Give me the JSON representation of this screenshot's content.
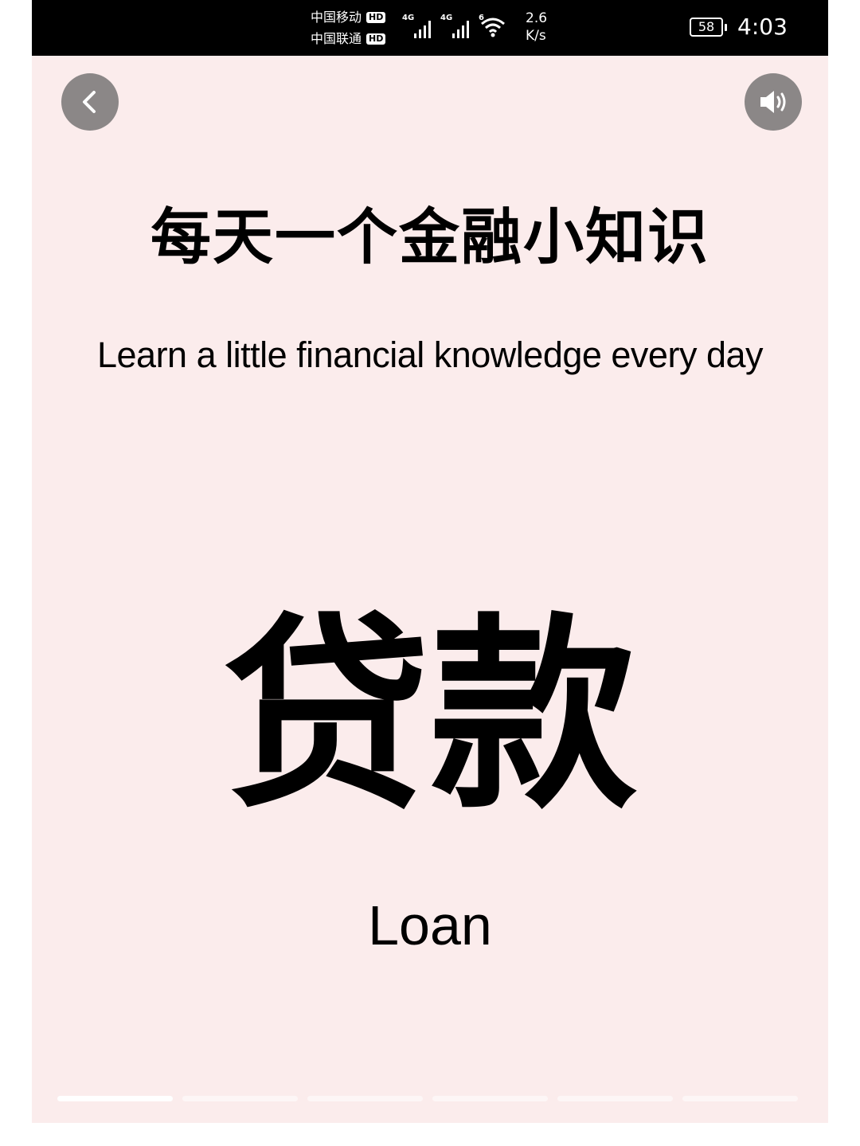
{
  "status_bar": {
    "carrier_1": "中国移动",
    "carrier_2": "中国联通",
    "hd_label": "HD",
    "signal_1_tag": "4G",
    "signal_2_tag": "4G",
    "wifi_tag": "6",
    "speed_value": "2.6",
    "speed_unit": "K/s",
    "battery": "58",
    "time": "4:03",
    "icons": [
      "signal-icon",
      "wifi-icon",
      "battery-icon"
    ]
  },
  "toolbar": {
    "back_icon": "chevron-left-icon",
    "sound_icon": "speaker-icon"
  },
  "content": {
    "title_cn": "每天一个金融小知识",
    "title_en": "Learn a little financial knowledge every day",
    "term_cn": "贷款",
    "term_en": "Loan"
  },
  "progress": {
    "segments": [
      1,
      0,
      0,
      0,
      0,
      0
    ]
  },
  "colors": {
    "background": "#fbecec",
    "status_bar": "#000000",
    "button": "#8b8787",
    "text": "#000000"
  }
}
